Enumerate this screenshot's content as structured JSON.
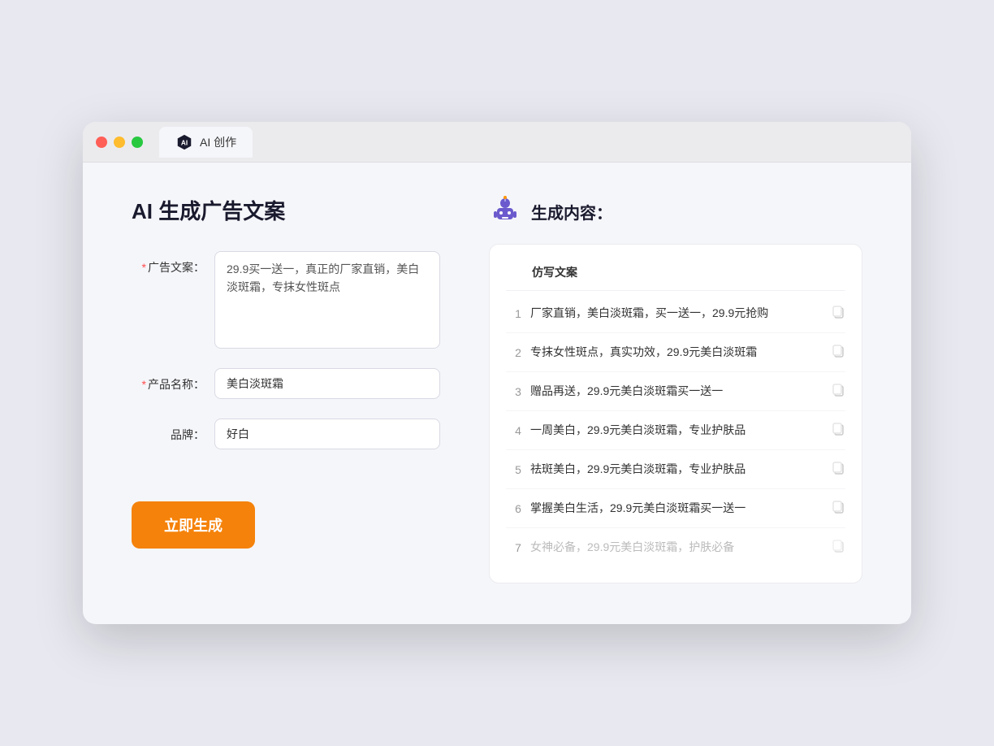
{
  "browser": {
    "tab_label": "AI 创作"
  },
  "left_panel": {
    "title": "AI 生成广告文案",
    "ad_copy_label": "广告文案：",
    "ad_copy_required": "*",
    "ad_copy_value": "29.9买一送一，真正的厂家直销，美白淡斑霜，专抹女性斑点",
    "product_label": "产品名称：",
    "product_required": "*",
    "product_value": "美白淡斑霜",
    "brand_label": "品牌：",
    "brand_value": "好白",
    "generate_btn": "立即生成"
  },
  "right_panel": {
    "title": "生成内容：",
    "table_header": "仿写文案",
    "results": [
      {
        "num": "1",
        "text": "厂家直销，美白淡斑霜，买一送一，29.9元抢购",
        "dimmed": false
      },
      {
        "num": "2",
        "text": "专抹女性斑点，真实功效，29.9元美白淡斑霜",
        "dimmed": false
      },
      {
        "num": "3",
        "text": "赠品再送，29.9元美白淡斑霜买一送一",
        "dimmed": false
      },
      {
        "num": "4",
        "text": "一周美白，29.9元美白淡斑霜，专业护肤品",
        "dimmed": false
      },
      {
        "num": "5",
        "text": "祛斑美白，29.9元美白淡斑霜，专业护肤品",
        "dimmed": false
      },
      {
        "num": "6",
        "text": "掌握美白生活，29.9元美白淡斑霜买一送一",
        "dimmed": false
      },
      {
        "num": "7",
        "text": "女神必备，29.9元美白淡斑霜，护肤必备",
        "dimmed": true
      }
    ]
  },
  "colors": {
    "accent": "#f5820a",
    "primary_purple": "#6a5acd"
  }
}
